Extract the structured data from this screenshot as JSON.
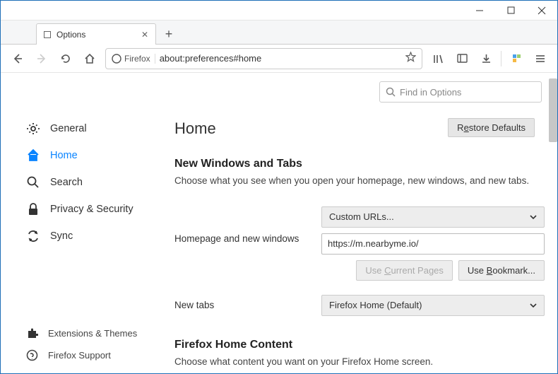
{
  "window": {
    "tab_title": "Options"
  },
  "urlbar": {
    "branding": "Firefox",
    "url": "about:preferences#home"
  },
  "search": {
    "placeholder": "Find in Options"
  },
  "sidebar": {
    "items": [
      {
        "label": "General"
      },
      {
        "label": "Home"
      },
      {
        "label": "Search"
      },
      {
        "label": "Privacy & Security"
      },
      {
        "label": "Sync"
      }
    ],
    "footer": [
      {
        "label": "Extensions & Themes"
      },
      {
        "label": "Firefox Support"
      }
    ]
  },
  "page": {
    "title": "Home",
    "restore_pre": "R",
    "restore_ul": "e",
    "restore_post": "store Defaults",
    "sec1_title": "New Windows and Tabs",
    "sec1_desc": "Choose what you see when you open your homepage, new windows, and new tabs.",
    "hp_label": "Homepage and new windows",
    "hp_select": "Custom URLs...",
    "hp_value": "https://m.nearbyme.io/",
    "btn_current_pre": "Use ",
    "btn_current_ul": "C",
    "btn_current_post": "urrent Pages",
    "btn_bookmark_pre": "Use ",
    "btn_bookmark_ul": "B",
    "btn_bookmark_post": "ookmark...",
    "nt_label": "New tabs",
    "nt_select": "Firefox Home (Default)",
    "sec2_title": "Firefox Home Content",
    "sec2_desc": "Choose what content you want on your Firefox Home screen."
  }
}
